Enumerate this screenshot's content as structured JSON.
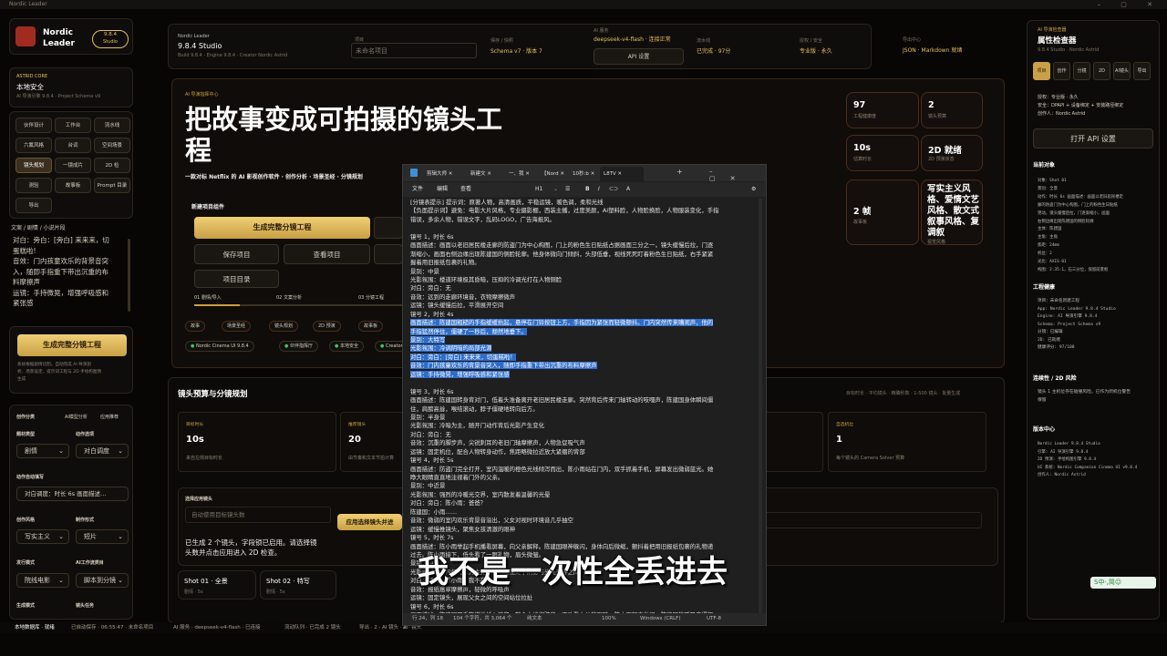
{
  "os": {
    "title": "Nordic Leader"
  },
  "brand": {
    "name1": "Nordic",
    "name2": "Leader",
    "version_badge1": "9.8.4",
    "version_badge2": "Studio"
  },
  "core": {
    "label": "ASTRID CORE",
    "title": "本地安全",
    "sub": "AI 导演引擎 9.8.4 · Project Schema v9"
  },
  "nav": [
    [
      "伙伴设计",
      "工作台",
      "流水线"
    ],
    [
      "六氟风格",
      "台词",
      "空间场景"
    ],
    [
      "镜头规划",
      "一镜成片",
      "2D 检"
    ],
    [
      "测验",
      "故事板",
      "Prompt 目录"
    ],
    [
      "导出"
    ]
  ],
  "script_section": {
    "title": "文案 / 剧情 / 小说片段",
    "lines": [
      "对白：旁白：[旁白] 来来来，切",
      "蛋糕啦!",
      "音效：门内孩童欢乐的背景音突",
      "入，随即手指重下带出沉重的布",
      "料摩擦声",
      "运镜：手持微晃，增强呼吸感和",
      "紧张感"
    ]
  },
  "left_generate": {
    "label": "生成完整分镜工程",
    "desc": [
      "系统根据剧情切割，自动完成 AI 导演剖",
      "析、场景设定、提示词工程与 2D 手绘构图预",
      "生成"
    ]
  },
  "left_form": {
    "row1": [
      "创作分类",
      "AI模型分析",
      "应用推荐"
    ],
    "fields": [
      {
        "label": "题材类型",
        "value": "剧情"
      },
      {
        "label": "动作选项",
        "value": "对白调度"
      }
    ],
    "auto_label": "动作自动填写",
    "auto_value": "对白调度：时长 6s 画面描述...",
    "fields2": [
      {
        "label": "创作风格",
        "value": "写实主义"
      },
      {
        "label": "制作形式",
        "value": "短片"
      }
    ],
    "fields3": [
      {
        "label": "发行模式",
        "value": "院线电影"
      },
      {
        "label": "AI工作流类目",
        "value": "脚本到分镜"
      }
    ],
    "foot": [
      "生成模式",
      "镜头任务"
    ]
  },
  "header": {
    "tag": "Nordic Leader",
    "title": "9.8.4 Studio",
    "sub": "Build 9.8.4 · Engine 9.8.4 · Creator Nordic Astrid",
    "project_label": "项目",
    "project_placeholder": "未命名项目",
    "schema_label": "保存 / 快照",
    "schema_value": "Schema v7 · 版本 7",
    "ai_label": "AI 服务",
    "ai_value": "deepseek-v4-flash · 连接正常",
    "ai_btn": "API 设置",
    "stream_label": "流水线",
    "stream_value": "已完成 · 97分",
    "license_label": "授权 / 安全",
    "license_value": "专业版 · 永久",
    "export_label": "导出中心",
    "export_value": "JSON · Markdown 就绪"
  },
  "hero": {
    "tag": "AI 导演指挥中心",
    "title1": "把故事变成可拍摄的镜头工",
    "title2": "程",
    "sub": "一款对标 Netflix 的 AI 影视创作软件 · 创作分析 · 场景圣经 · 分镜规划",
    "quick_title": "新建项目组件",
    "gen_btn": "生成完整分镜工程",
    "save_btn": "保存项目",
    "view_btn": "查看项目",
    "dir_btn": "项目目录",
    "steps": [
      "01 剧情/导入",
      "02 文案分析",
      "03 分镜工程"
    ]
  },
  "pills": [
    "故事",
    "场景圣经",
    "镜头规划",
    "2D 预演",
    "故事板"
  ],
  "chips": [
    "Nordic Cinema UI 9.8.4",
    "伙伴指挥厅",
    "本地安全",
    "Creator"
  ],
  "stats": [
    {
      "value": "97",
      "label": "工程健康度"
    },
    {
      "value": "2",
      "label": "镜头预算"
    },
    {
      "value": "10s",
      "label": "估算时长"
    },
    {
      "value": "2D 就绪",
      "label": "2D 预演状态"
    },
    {
      "value": "2 帧",
      "label": "故事板"
    },
    {
      "value": "写实主义风格、爱情文艺风格、散文式叙事风格、复调叙",
      "label": "视觉风格"
    }
  ],
  "budget": {
    "title": "镜头预算与分镜规划",
    "right": "目标时长 · 平均镜头 · 精确秒数 · 1-500 镜头 · 批量生成",
    "cards": [
      {
        "label": "目标时长",
        "value": "10s",
        "desc": "来自左侧目标时长"
      },
      {
        "label": "推荐镜头",
        "value": "20",
        "desc": "由节奏和文本节拍计算"
      },
      {
        "label": "",
        "value": "",
        "desc": ""
      },
      {
        "label": "",
        "value": "",
        "desc": ""
      },
      {
        "label": "自选机位",
        "value": "1",
        "desc": "每个镜头的 Camera Solver 预算"
      }
    ],
    "apply_label": "选择应用镜头",
    "apply_placeholder": "自动使用目标镜头数",
    "apply_btn": "应用选择镜头并进",
    "apply_desc1": "已生成 2 个镜头，字段锁已启用。请选择镜",
    "apply_desc2": "头数并点击应用进入 2D 检查。",
    "shots": [
      {
        "title": "Shot 01 · 全景",
        "sub": "剧情 · 5s"
      },
      {
        "title": "Shot 02 · 特写",
        "sub": "剧情 · 5s"
      }
    ]
  },
  "inspector": {
    "tag": "AI 导演检查器",
    "title": "属性检查器",
    "sub": "9.8.4 Studio · Nordic Astrid",
    "tabs": [
      "项目",
      "创作",
      "分镜",
      "2D",
      "AI镜头",
      "导出"
    ],
    "lines": [
      "授权：专业版 · 永久",
      "安全：DPAPI + 设备绑定 + 安装路径绑定",
      "创作人：Nordic Astrid"
    ],
    "btn": "打开 API 设置",
    "current_title": "当前对象",
    "current": [
      "对象：Shot 01",
      "景别：全景",
      "动作：时长 6s 画面描述：画面以老旧居民楼走",
      "廊的防盗门为中心构图，门上的粉色生日贴纸",
      "晃动，镜头缓慢后拉，门逐渐缩小，画面",
      "右侧边缘出现陈建国的侧脸轮廓",
      "主体：陈建国",
      "主角：主角",
      "焦距：24mm",
      "机位：2",
      "光比：AXIS-01",
      "构图：2.35:1，石三分位，保留前景框"
    ],
    "eng_title": "工程健康",
    "eng": [
      "项目：未命名新建工程",
      "App: Nordic Leader 9.8.4 Studio",
      "Engine: AI 导演引擎 9.8.4",
      "Schema: Project Schema v9",
      "分镜：已编辑",
      "2D: 已就绪",
      "健康评分: 97/100"
    ],
    "cont_title": "连续性 / 2D 风险",
    "cont": [
      "镜头 1 主机位存在碰撞风险，已作为闭机位警告",
      "保留"
    ],
    "ver_title": "版本中心",
    "ver": [
      "Nordic Leader 9.8.4 Studio",
      "引擎: AI 导演引擎 9.8.4",
      "2D 预演: 手绘构图引擎 9.8.4",
      "UI 系统: Nordic Companion Cinema UI v9.8.4",
      "创作人: Nordic Astrid"
    ]
  },
  "status_bar": [
    "本地数据库 · 就绪",
    "已自动保存 · 06:55:47 · 未命名项目",
    "AI 服务 · deepseek-v4-flash · 已连接",
    "流动队列 · 已完成 2 镜头",
    "导出 · 2 · AI 镜头 · 2 · 镜头",
    "AI"
  ],
  "notepad": {
    "tabs": [
      "剪辑大师",
      "新建文",
      "一、我",
      "【Nord",
      "10秒:b",
      "L8TV"
    ],
    "menu": [
      "文件",
      "编辑",
      "查看"
    ],
    "fmt": "H1",
    "lines": [
      "[分镜表提示] 提示词：原著人物，高清画质，平稳运镜，暖色调，柔和光线",
      "【负面提示词】避免：电影大片风格，专业摄影棚，西装主播，过度美颜，AI塑料脸，人物脸换脸，人物服装变化，手指",
      "错误，多余人物，错误文字，乱码LOGO，广告海报风。",
      "",
      "镜号 1，时长 6s",
      "画面描述：画面以老旧居民楼走廊的防盗门为中心构图，门上的粉色生日贴纸占据画面三分之一，镜头缓慢后拉，门逐",
      "渐缩小，画面右侧边缘出现陈建国的侧脸轮廓。他身体微向门倾斜，头部低垂，视线死死盯着粉色生日贴纸，右手紧紧",
      "握着用旧报纸包裹的礼物。",
      "景别：中景",
      "光影氛围：楼道环境极其昏暗，压抑的冷调光打在人物侧脸",
      "对白：旁白：无",
      "音效：远到的走廊环境音，衣物摩擦微声",
      "运镜：镜头缓慢后拉，平滑展开空间",
      "镜号 2，时长 4s",
      "画面描述：陈建国粗糙的手指缓缓抬起，悬停在门铃按钮上方，手指因为紧张而轻微颤抖。门内突然传来嘈闹声，他的",
      "手指猛然停住，僵硬了一秒后，颓然地垂下。",
      "景别：大特写",
      "光影氛围：冷调阴暗的局部光源",
      "对白：旁白：[旁白] 来来来，切蛋糕啦！",
      "音效：门内孩童欢乐的背景音突入，随即手指重下带出沉重的布料摩擦声",
      "运镜：手持微晃，增强呼吸感和紧张感",
      "",
      "镜号 3，时长 6s",
      "画面描述：陈建国转身背对门，低着头准备离开老旧居民楼走廊。突然背后传来门轴转动的吱嘎声，陈建国身体瞬间僵",
      "住，肩膀高耸，喉结滚动，脖子僵硬地转向后方。",
      "景别：半身景",
      "光影氛围：冷暗为主，随开门动作背后光影产生变化",
      "对白：旁白：无",
      "音效：沉重的脚步声，尖锐刺耳的老旧门轴摩擦声，人物急促吸气声",
      "运镜：固定机位，配合人物转身动作，焦距略微拉近放大紧绷的背部",
      "镜号 4，时长 5s",
      "画面描述：防盗门完全打开，室内温暖的橙色光线倾泻而出，陈小雨站在门内，双手抓着手机，屏幕发出微弱蓝光。她",
      "睁大眼睛直直地注视着门外的父亲。",
      "景别：中近景",
      "光影氛围：强烈的冷暖光交界，室内散发着温馨的光晕",
      "对白：旁白：陈小雨：爸爸？",
      "陈建国：小雨……",
      "音效：微弱的室内欢乐背景音溢出，父女对视时环境音几乎抽空",
      "运镜：缓慢推镜头，聚焦女孩清澈的眼神",
      "镜号 5，时长 7s",
      "画面描述：陈小雨举起手机播看屏幕，向父亲解释。陈建国眼神躲闪，身体向后微缩，颤抖着把用旧报纸包裹的礼物递",
      "过去。陈小雨接下，低头看了一眼礼物，眉头微皱。",
      "景别：中景",
      "光影氛围：门内灯光作为主光源，陈建国处于阴影与光亮交界之间",
      "对白：旁白：陈小雨：我不在……",
      "音效：报纸窸窣摩擦声，轻微的呼吸声",
      "运镜：固定镜头，展现父女之间的空间站位拉扯",
      "镜号 6，时长 6s",
      "画面描述：陈建国双手抱谨地插入裤兜，整个人蜷缩驼背，不敢看女儿的眼睛。陈小雨轻声发问，陈建国的呼吸变得粗"
    ],
    "hl_from": 14,
    "hl_to": 20,
    "status": [
      "行 24，列 18",
      "104 个字符，共 3,064 个",
      "纯文本",
      "100%",
      "Windows (CRLF)",
      "UTF-8"
    ]
  },
  "overlay": {
    "subtitle": "我不是一次性全丢进去",
    "ime": "S中·,简☺"
  }
}
